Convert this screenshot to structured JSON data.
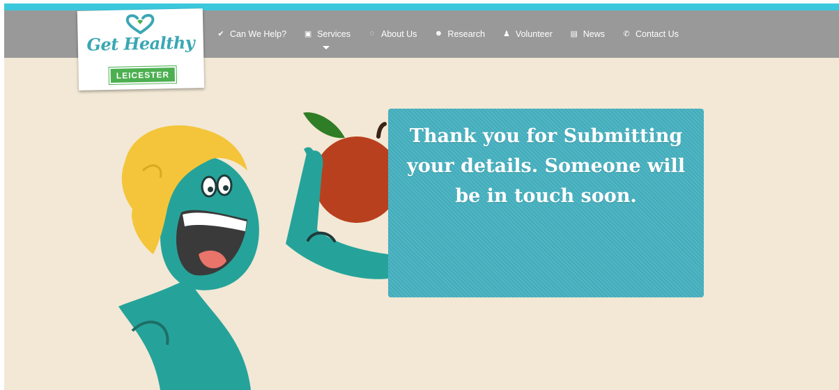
{
  "colors": {
    "accent": "#3cc8dc",
    "nav_background": "#999999",
    "page_background": "#f2e8d5",
    "message_box": "#47b2c1",
    "logo_green": "#4caf50",
    "logo_teal": "#3aa7b4"
  },
  "logo": {
    "title": "Get Healthy",
    "badge": "LEICESTER",
    "icon": "heart-hands-icon"
  },
  "nav": {
    "items": [
      {
        "label": "Can We Help?",
        "icon": "check-icon",
        "glyph": "✔"
      },
      {
        "label": "Services",
        "icon": "services-icon",
        "glyph": "▣",
        "has_dropdown": true
      },
      {
        "label": "About Us",
        "icon": "chat-icon",
        "glyph": "◌"
      },
      {
        "label": "Research",
        "icon": "group-icon",
        "glyph": "☻"
      },
      {
        "label": "Volunteer",
        "icon": "add-user-icon",
        "glyph": "♟"
      },
      {
        "label": "News",
        "icon": "newspaper-icon",
        "glyph": "▤"
      },
      {
        "label": "Contact Us",
        "icon": "phone-icon",
        "glyph": "✆"
      }
    ]
  },
  "message": {
    "text": "Thank you for Submitting your details. Someone will be in touch soon."
  }
}
